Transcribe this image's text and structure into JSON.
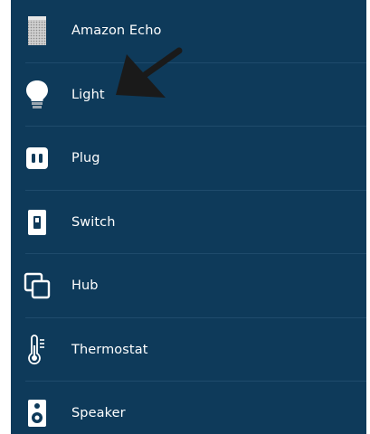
{
  "device_list": {
    "items": [
      {
        "label": "Amazon Echo",
        "icon": "echo-speaker-icon"
      },
      {
        "label": "Light",
        "icon": "lightbulb-icon"
      },
      {
        "label": "Plug",
        "icon": "plug-icon"
      },
      {
        "label": "Switch",
        "icon": "switch-icon"
      },
      {
        "label": "Hub",
        "icon": "hub-icon"
      },
      {
        "label": "Thermostat",
        "icon": "thermometer-icon"
      },
      {
        "label": "Speaker",
        "icon": "speaker-icon"
      }
    ]
  },
  "colors": {
    "background": "#0e3a5a",
    "divider": "#1f4b6c",
    "text": "#ffffff",
    "annotation": "#1a1a1a"
  }
}
